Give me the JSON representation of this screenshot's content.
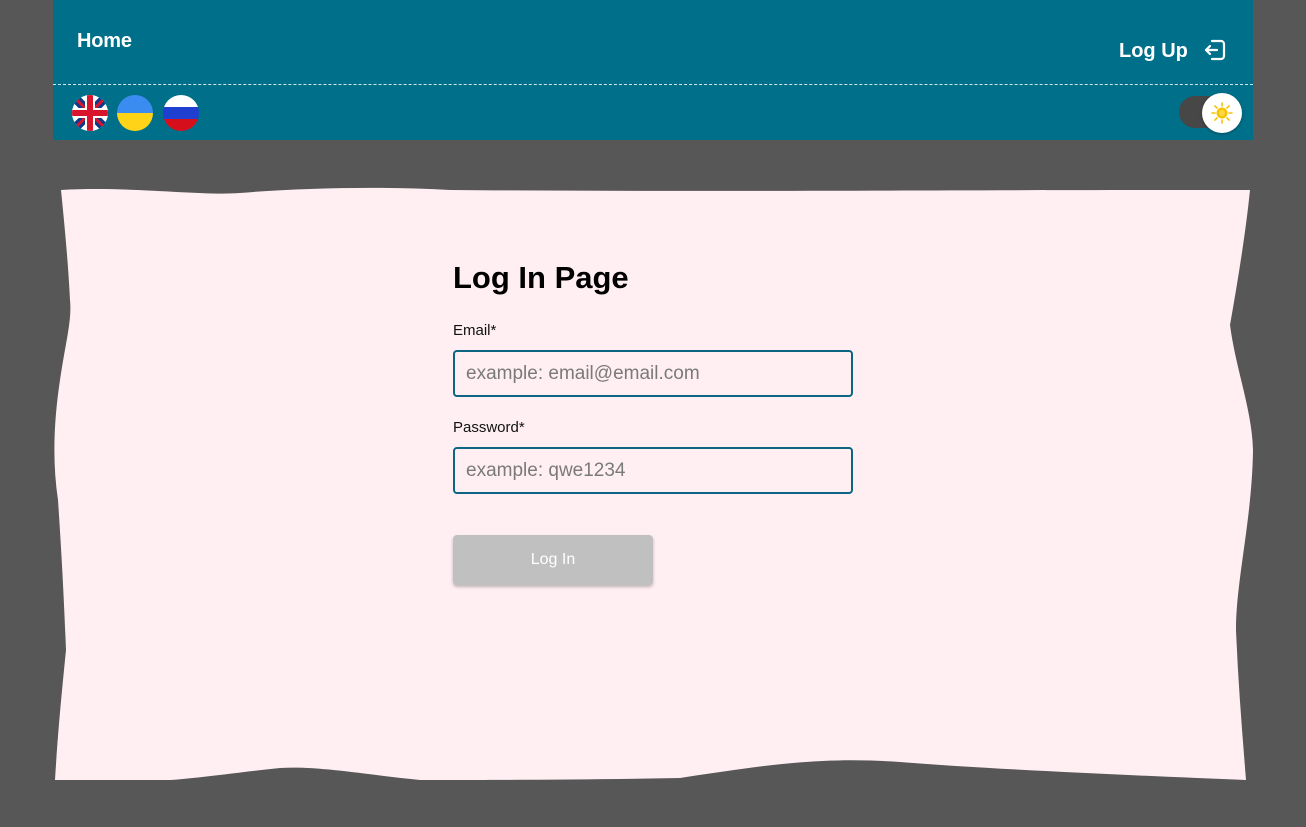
{
  "header": {
    "home_label": "Home",
    "logup_label": "Log Up",
    "logup_icon": "login-arrow-icon",
    "languages": [
      {
        "code": "en",
        "icon": "uk-flag-icon"
      },
      {
        "code": "ua",
        "icon": "ukraine-flag-icon"
      },
      {
        "code": "ru",
        "icon": "russia-flag-icon"
      }
    ],
    "theme_toggle_icon": "sun-icon"
  },
  "form": {
    "title": "Log In Page",
    "email_label": "Email*",
    "email_placeholder": "example: email@email.com",
    "email_value": "",
    "password_label": "Password*",
    "password_placeholder": "example: qwe1234",
    "password_value": "",
    "submit_label": "Log In"
  },
  "colors": {
    "page_background": "#575757",
    "header_background": "#00708a",
    "card_background": "#ffeff3",
    "input_border": "#0c6582",
    "button_disabled": "#c0c0c0",
    "sun": "#f5c400"
  }
}
